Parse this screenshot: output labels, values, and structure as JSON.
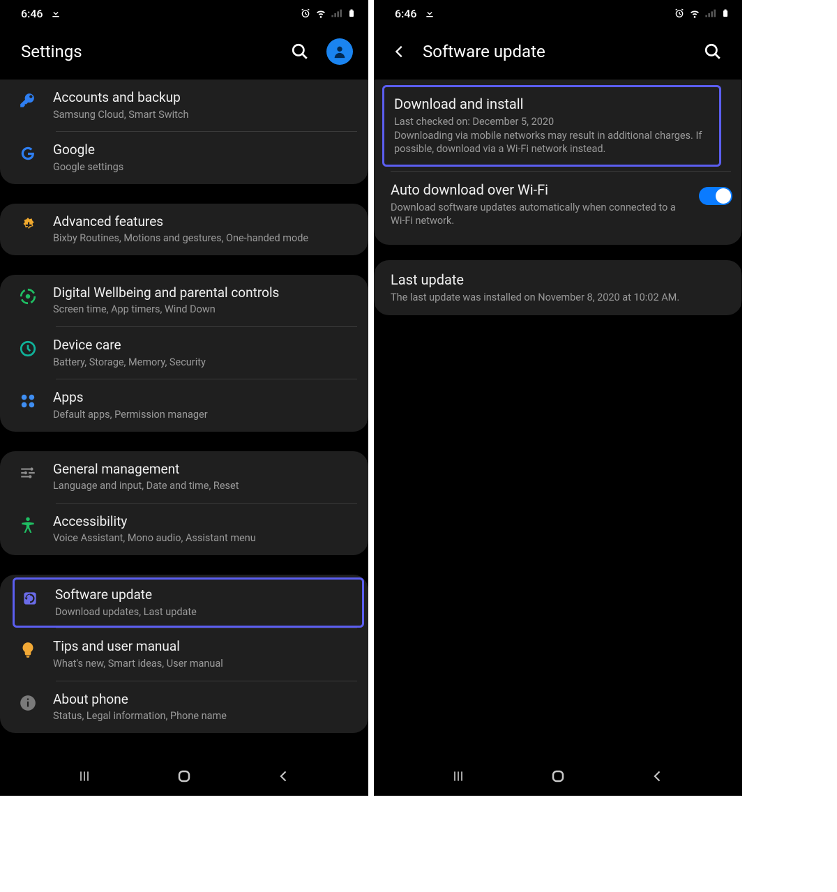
{
  "status": {
    "time": "6:46"
  },
  "left": {
    "title": "Settings",
    "groups": [
      [
        {
          "title": "Accounts and backup",
          "sub": "Samsung Cloud, Smart Switch",
          "icon": "key"
        },
        {
          "title": "Google",
          "sub": "Google settings",
          "icon": "google"
        }
      ],
      [
        {
          "title": "Advanced features",
          "sub": "Bixby Routines, Motions and gestures, One-handed mode",
          "icon": "plus-gear"
        }
      ],
      [
        {
          "title": "Digital Wellbeing and parental controls",
          "sub": "Screen time, App timers, Wind Down",
          "icon": "wellbeing"
        },
        {
          "title": "Device care",
          "sub": "Battery, Storage, Memory, Security",
          "icon": "care"
        },
        {
          "title": "Apps",
          "sub": "Default apps, Permission manager",
          "icon": "apps"
        }
      ],
      [
        {
          "title": "General management",
          "sub": "Language and input, Date and time, Reset",
          "icon": "sliders"
        },
        {
          "title": "Accessibility",
          "sub": "Voice Assistant, Mono audio, Assistant menu",
          "icon": "accessibility"
        }
      ],
      [
        {
          "title": "Software update",
          "sub": "Download updates, Last update",
          "icon": "update",
          "highlighted": true
        },
        {
          "title": "Tips and user manual",
          "sub": "What's new, Smart ideas, User manual",
          "icon": "bulb"
        },
        {
          "title": "About phone",
          "sub": "Status, Legal information, Phone name",
          "icon": "info"
        }
      ]
    ]
  },
  "right": {
    "title": "Software update",
    "items": {
      "download": {
        "title": "Download and install",
        "line1": "Last checked on: December 5, 2020",
        "line2": "Downloading via mobile networks may result in additional charges. If possible, download via a Wi-Fi network instead."
      },
      "auto": {
        "title": "Auto download over Wi-Fi",
        "sub": "Download software updates automatically when connected to a Wi-Fi network.",
        "enabled": true
      },
      "last": {
        "title": "Last update",
        "sub": "The last update was installed on November 8, 2020 at 10:02 AM."
      }
    }
  }
}
